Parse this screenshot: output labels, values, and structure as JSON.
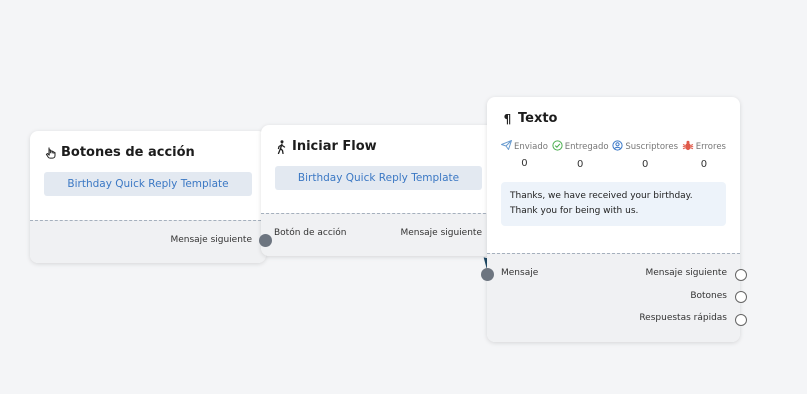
{
  "nodes": {
    "botones": {
      "title": "Botones de acción",
      "template_button": "Birthday Quick Reply Template",
      "out_label": "Mensaje siguiente"
    },
    "flow": {
      "title": "Iniciar Flow",
      "template_button": "Birthday Quick Reply Template",
      "in_label": "Botón de acción",
      "out_label": "Mensaje siguiente"
    },
    "texto": {
      "title": "Texto",
      "stats": [
        {
          "icon": "send-icon",
          "label": "Enviado",
          "value": "0",
          "color": "#6a9cd0"
        },
        {
          "icon": "check-circle-icon",
          "label": "Entregado",
          "value": "0",
          "color": "#4caf50"
        },
        {
          "icon": "user-circle-icon",
          "label": "Suscriptores",
          "value": "0",
          "color": "#3a78c8"
        },
        {
          "icon": "bug-icon",
          "label": "Errores",
          "value": "0",
          "color": "#e05a4a"
        }
      ],
      "message": "Thanks, we have received your birthday. Thank you for being with us.",
      "in_label": "Mensaje",
      "outputs": [
        "Mensaje siguiente",
        "Botones",
        "Respuestas rápidas"
      ]
    }
  },
  "colors": {
    "canvas": "#f4f5f7",
    "template_button_bg": "#e3e9f1",
    "template_button_text": "#3b78c4",
    "connector": "#1e4a66"
  }
}
